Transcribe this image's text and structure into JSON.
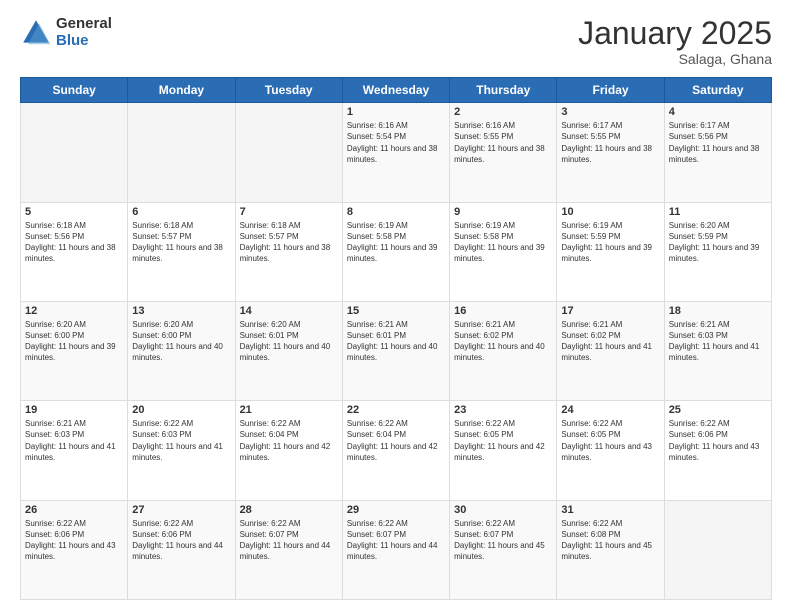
{
  "logo": {
    "general": "General",
    "blue": "Blue"
  },
  "header": {
    "month": "January 2025",
    "location": "Salaga, Ghana"
  },
  "weekdays": [
    "Sunday",
    "Monday",
    "Tuesday",
    "Wednesday",
    "Thursday",
    "Friday",
    "Saturday"
  ],
  "weeks": [
    [
      {
        "day": "",
        "sunrise": "",
        "sunset": "",
        "daylight": ""
      },
      {
        "day": "",
        "sunrise": "",
        "sunset": "",
        "daylight": ""
      },
      {
        "day": "",
        "sunrise": "",
        "sunset": "",
        "daylight": ""
      },
      {
        "day": "1",
        "sunrise": "6:16 AM",
        "sunset": "5:54 PM",
        "daylight": "11 hours and 38 minutes."
      },
      {
        "day": "2",
        "sunrise": "6:16 AM",
        "sunset": "5:55 PM",
        "daylight": "11 hours and 38 minutes."
      },
      {
        "day": "3",
        "sunrise": "6:17 AM",
        "sunset": "5:55 PM",
        "daylight": "11 hours and 38 minutes."
      },
      {
        "day": "4",
        "sunrise": "6:17 AM",
        "sunset": "5:56 PM",
        "daylight": "11 hours and 38 minutes."
      }
    ],
    [
      {
        "day": "5",
        "sunrise": "6:18 AM",
        "sunset": "5:56 PM",
        "daylight": "11 hours and 38 minutes."
      },
      {
        "day": "6",
        "sunrise": "6:18 AM",
        "sunset": "5:57 PM",
        "daylight": "11 hours and 38 minutes."
      },
      {
        "day": "7",
        "sunrise": "6:18 AM",
        "sunset": "5:57 PM",
        "daylight": "11 hours and 38 minutes."
      },
      {
        "day": "8",
        "sunrise": "6:19 AM",
        "sunset": "5:58 PM",
        "daylight": "11 hours and 39 minutes."
      },
      {
        "day": "9",
        "sunrise": "6:19 AM",
        "sunset": "5:58 PM",
        "daylight": "11 hours and 39 minutes."
      },
      {
        "day": "10",
        "sunrise": "6:19 AM",
        "sunset": "5:59 PM",
        "daylight": "11 hours and 39 minutes."
      },
      {
        "day": "11",
        "sunrise": "6:20 AM",
        "sunset": "5:59 PM",
        "daylight": "11 hours and 39 minutes."
      }
    ],
    [
      {
        "day": "12",
        "sunrise": "6:20 AM",
        "sunset": "6:00 PM",
        "daylight": "11 hours and 39 minutes."
      },
      {
        "day": "13",
        "sunrise": "6:20 AM",
        "sunset": "6:00 PM",
        "daylight": "11 hours and 40 minutes."
      },
      {
        "day": "14",
        "sunrise": "6:20 AM",
        "sunset": "6:01 PM",
        "daylight": "11 hours and 40 minutes."
      },
      {
        "day": "15",
        "sunrise": "6:21 AM",
        "sunset": "6:01 PM",
        "daylight": "11 hours and 40 minutes."
      },
      {
        "day": "16",
        "sunrise": "6:21 AM",
        "sunset": "6:02 PM",
        "daylight": "11 hours and 40 minutes."
      },
      {
        "day": "17",
        "sunrise": "6:21 AM",
        "sunset": "6:02 PM",
        "daylight": "11 hours and 41 minutes."
      },
      {
        "day": "18",
        "sunrise": "6:21 AM",
        "sunset": "6:03 PM",
        "daylight": "11 hours and 41 minutes."
      }
    ],
    [
      {
        "day": "19",
        "sunrise": "6:21 AM",
        "sunset": "6:03 PM",
        "daylight": "11 hours and 41 minutes."
      },
      {
        "day": "20",
        "sunrise": "6:22 AM",
        "sunset": "6:03 PM",
        "daylight": "11 hours and 41 minutes."
      },
      {
        "day": "21",
        "sunrise": "6:22 AM",
        "sunset": "6:04 PM",
        "daylight": "11 hours and 42 minutes."
      },
      {
        "day": "22",
        "sunrise": "6:22 AM",
        "sunset": "6:04 PM",
        "daylight": "11 hours and 42 minutes."
      },
      {
        "day": "23",
        "sunrise": "6:22 AM",
        "sunset": "6:05 PM",
        "daylight": "11 hours and 42 minutes."
      },
      {
        "day": "24",
        "sunrise": "6:22 AM",
        "sunset": "6:05 PM",
        "daylight": "11 hours and 43 minutes."
      },
      {
        "day": "25",
        "sunrise": "6:22 AM",
        "sunset": "6:06 PM",
        "daylight": "11 hours and 43 minutes."
      }
    ],
    [
      {
        "day": "26",
        "sunrise": "6:22 AM",
        "sunset": "6:06 PM",
        "daylight": "11 hours and 43 minutes."
      },
      {
        "day": "27",
        "sunrise": "6:22 AM",
        "sunset": "6:06 PM",
        "daylight": "11 hours and 44 minutes."
      },
      {
        "day": "28",
        "sunrise": "6:22 AM",
        "sunset": "6:07 PM",
        "daylight": "11 hours and 44 minutes."
      },
      {
        "day": "29",
        "sunrise": "6:22 AM",
        "sunset": "6:07 PM",
        "daylight": "11 hours and 44 minutes."
      },
      {
        "day": "30",
        "sunrise": "6:22 AM",
        "sunset": "6:07 PM",
        "daylight": "11 hours and 45 minutes."
      },
      {
        "day": "31",
        "sunrise": "6:22 AM",
        "sunset": "6:08 PM",
        "daylight": "11 hours and 45 minutes."
      },
      {
        "day": "",
        "sunrise": "",
        "sunset": "",
        "daylight": ""
      }
    ]
  ]
}
